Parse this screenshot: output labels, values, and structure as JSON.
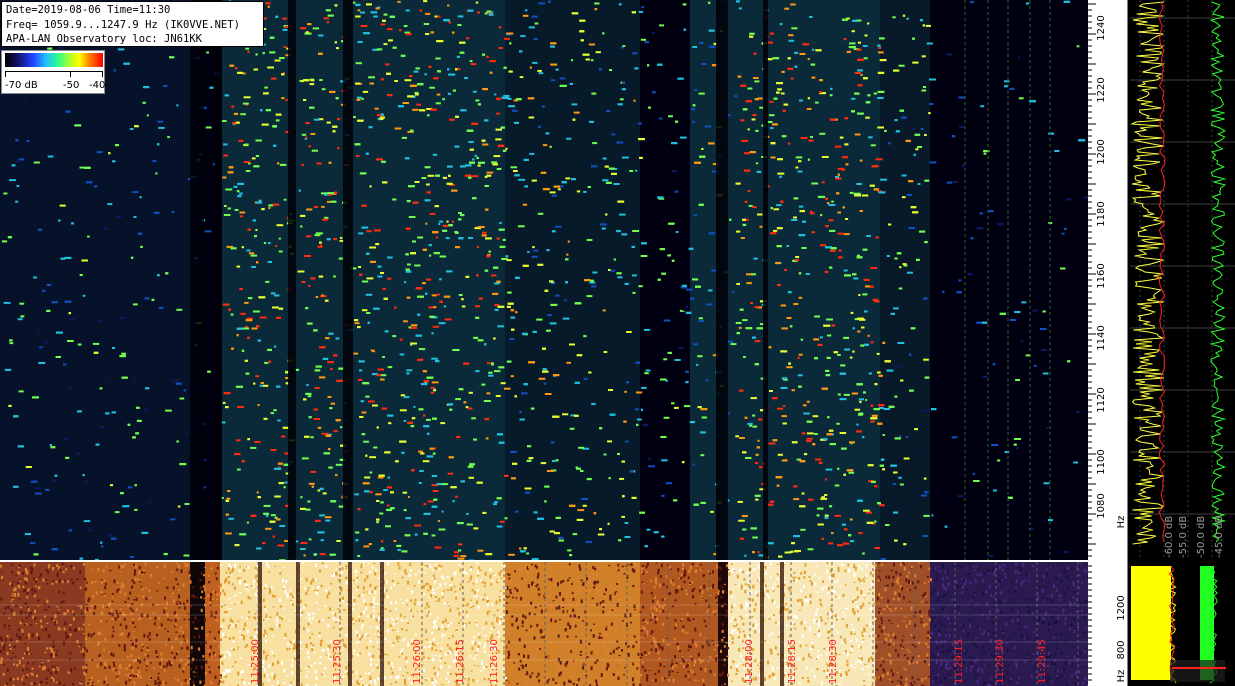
{
  "header": {
    "line1": "Date=2019-08-06 Time=11:30",
    "line2": "Freq= 1059.9...1247.9 Hz (IK0VVE.NET)",
    "line3": "APA-LAN Observatory loc: JN61KK"
  },
  "legend": {
    "labels": [
      "-70 dB",
      "-50",
      "-40"
    ]
  },
  "freq_axis": {
    "unit_label": "Hz",
    "ticks": [
      "1240",
      "1220",
      "1200",
      "1180",
      "1160",
      "1140",
      "1120",
      "1100",
      "1080"
    ]
  },
  "lower_axis": {
    "ticks": [
      "1200",
      "800"
    ],
    "unit_label": "Hz"
  },
  "db_labels": [
    "-60.0 dB",
    "-55.0 dB",
    "-50.0 dB",
    "-45.0 dB"
  ],
  "time_labels": [
    "11:25:00",
    "11:25:30",
    "11:26:00",
    "11:26:15",
    "11:26:30",
    "11:28:00",
    "11:28:15",
    "11:28:30",
    "11:29:15",
    "11:29:30",
    "11:29:45"
  ],
  "colors": {
    "background": "#000000",
    "spectrum_trace": "#ffff40",
    "average_trace": "#ff2020",
    "level_trace": "#30ff30",
    "time_label": "#ff2020"
  }
}
